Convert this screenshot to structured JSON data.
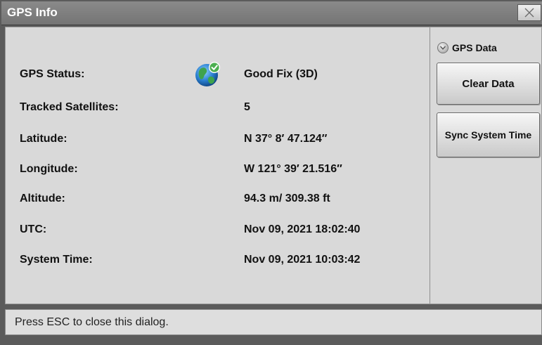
{
  "window": {
    "title": "GPS Info"
  },
  "info": {
    "rows": [
      {
        "label": "GPS Status:",
        "value": "Good Fix (3D)"
      },
      {
        "label": "Tracked Satellites:",
        "value": "5"
      },
      {
        "label": "Latitude:",
        "value": "N 37° 8′ 47.124″"
      },
      {
        "label": "Longitude:",
        "value": "W 121° 39′ 21.516″"
      },
      {
        "label": "Altitude:",
        "value": "94.3 m/ 309.38 ft"
      },
      {
        "label": "UTC:",
        "value": "Nov 09, 2021 18:02:40"
      },
      {
        "label": "System Time:",
        "value": "Nov 09, 2021 10:03:42"
      }
    ],
    "status_icon": "globe-check-icon"
  },
  "side": {
    "gps_data_label": "GPS Data",
    "clear_label": "Clear Data",
    "sync_label": "Sync System Time"
  },
  "status": {
    "text": "Press ESC to close this dialog."
  },
  "colors": {
    "titlebar": "#7d7d7d",
    "panel": "#d9d9d9",
    "globe_check": "#4caf50"
  }
}
